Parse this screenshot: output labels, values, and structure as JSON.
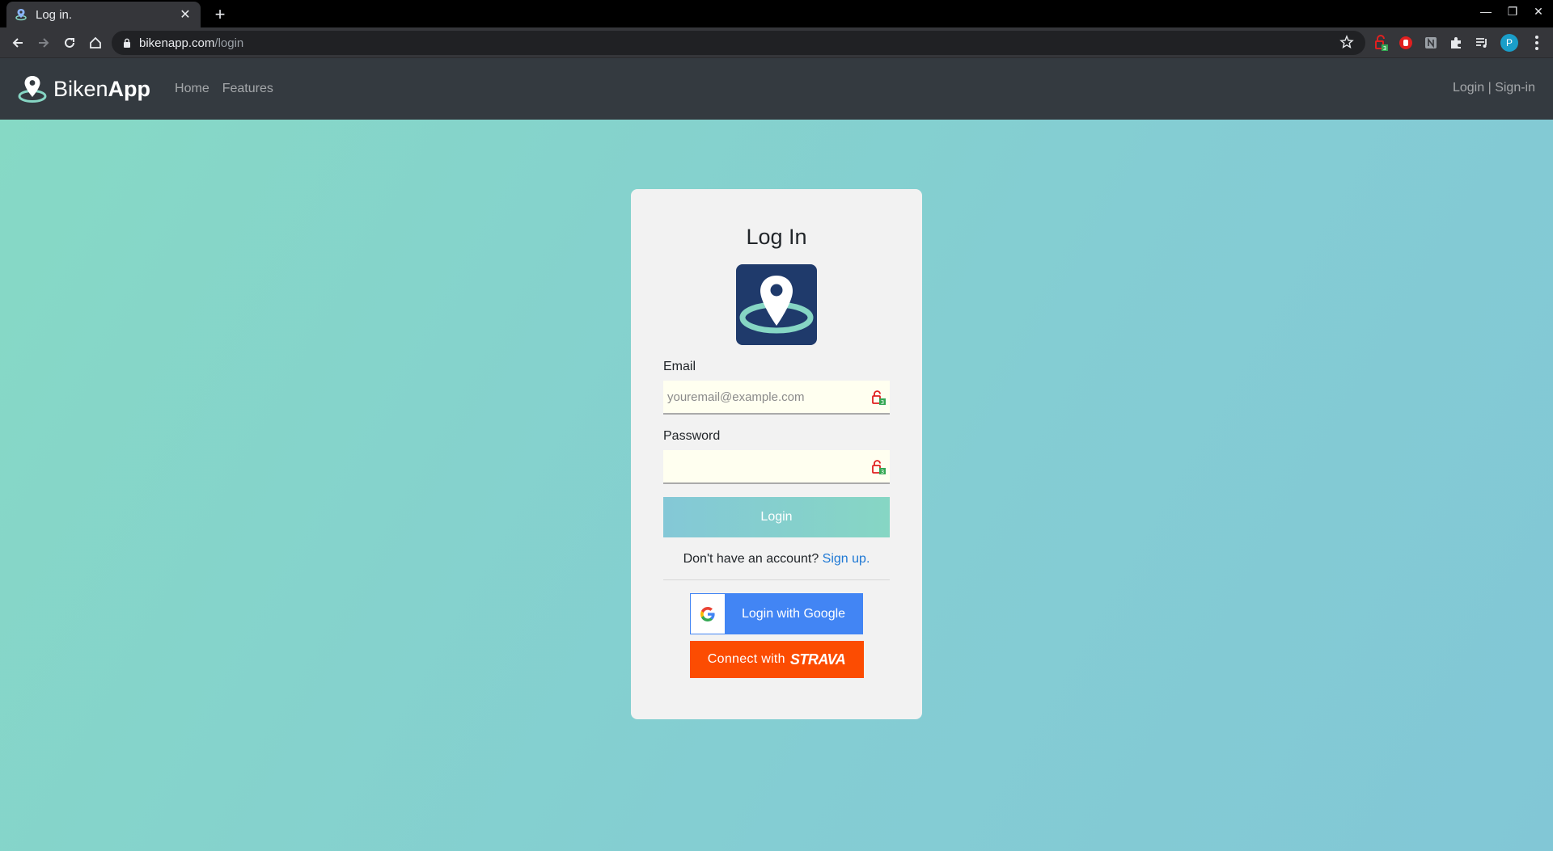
{
  "browser": {
    "tab_title": "Log in.",
    "new_tab": "+",
    "close_tab": "✕",
    "url_host": "bikenapp.com",
    "url_path": "/login",
    "profile_initial": "P",
    "window_minimize": "—",
    "window_restore": "❐",
    "window_close": "✕"
  },
  "navbar": {
    "brand_light": "Biken",
    "brand_bold": "App",
    "links": [
      "Home",
      "Features"
    ],
    "login_link": "Login",
    "separator": " | ",
    "signin_link": "Sign-in"
  },
  "login": {
    "title": "Log In",
    "email_label": "Email",
    "email_placeholder": "youremail@example.com",
    "email_value": "",
    "password_label": "Password",
    "password_value": "",
    "submit_label": "Login",
    "signup_prompt": "Don't have an account?",
    "signup_link": "Sign up.",
    "google_label": "Login with Google",
    "strava_prefix": "Connect with",
    "strava_word": "STRAVA"
  },
  "colors": {
    "navbar_bg": "#343a40",
    "card_bg": "#f2f2f2",
    "logo_bg": "#1f3a6b",
    "teal": "#86d6c4",
    "link": "#1e78d4",
    "google": "#4285f4",
    "strava": "#fc4c02"
  },
  "icons": {
    "brand": "map-pin-ring-icon",
    "back": "arrow-left-icon",
    "forward": "arrow-right-icon",
    "reload": "reload-icon",
    "home": "home-icon",
    "lock": "lock-icon",
    "star": "star-icon",
    "password_manager": "password-manager-icon",
    "google": "google-g-icon"
  }
}
